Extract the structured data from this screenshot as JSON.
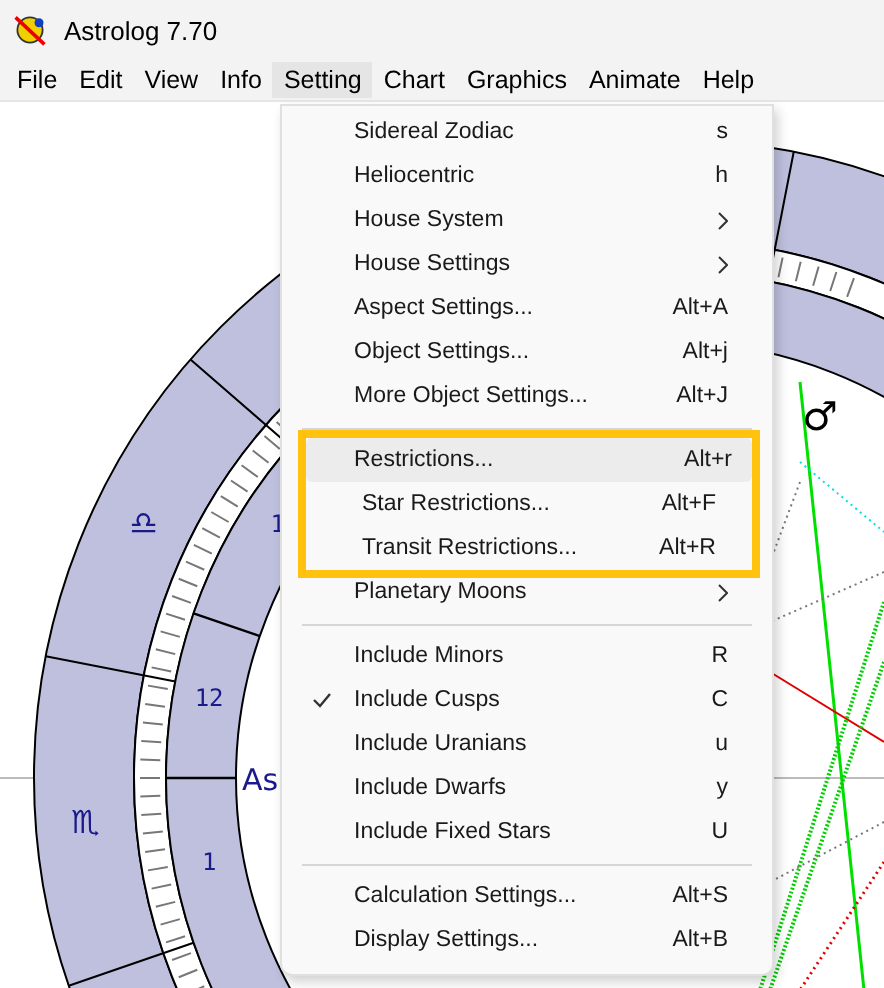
{
  "window": {
    "title": "Astrolog 7.70"
  },
  "menubar": [
    {
      "label": "File",
      "selected": false
    },
    {
      "label": "Edit",
      "selected": false
    },
    {
      "label": "View",
      "selected": false
    },
    {
      "label": "Info",
      "selected": false
    },
    {
      "label": "Setting",
      "selected": true
    },
    {
      "label": "Chart",
      "selected": false
    },
    {
      "label": "Graphics",
      "selected": false
    },
    {
      "label": "Animate",
      "selected": false
    },
    {
      "label": "Help",
      "selected": false
    }
  ],
  "chart": {
    "signs": [
      {
        "glyph": "♎"
      },
      {
        "glyph": "♏"
      }
    ],
    "houses": [
      {
        "label": "1"
      },
      {
        "label": "12"
      },
      {
        "label": "1"
      }
    ],
    "ascendant": "As",
    "planet": "♂"
  },
  "menu": {
    "groups": [
      {
        "highlighted": false,
        "items": [
          {
            "label": "Sidereal Zodiac",
            "shortcut": "s",
            "submenu": false,
            "checked": false,
            "selected": false
          },
          {
            "label": "Heliocentric",
            "shortcut": "h",
            "submenu": false,
            "checked": false,
            "selected": false
          },
          {
            "label": "House System",
            "submenu": true,
            "checked": false,
            "selected": false
          },
          {
            "label": "House Settings",
            "submenu": true,
            "checked": false,
            "selected": false
          },
          {
            "label": "Aspect Settings...",
            "shortcut": "Alt+A",
            "submenu": false,
            "checked": false,
            "selected": false
          },
          {
            "label": "Object Settings...",
            "shortcut": "Alt+j",
            "submenu": false,
            "checked": false,
            "selected": false
          },
          {
            "label": "More Object Settings...",
            "shortcut": "Alt+J",
            "submenu": false,
            "checked": false,
            "selected": false
          }
        ]
      },
      {
        "highlighted": true,
        "items": [
          {
            "label": "Restrictions...",
            "shortcut": "Alt+r",
            "submenu": false,
            "checked": false,
            "selected": true
          },
          {
            "label": "Star Restrictions...",
            "shortcut": "Alt+F",
            "submenu": false,
            "checked": false,
            "selected": false
          },
          {
            "label": "Transit Restrictions...",
            "shortcut": "Alt+R",
            "submenu": false,
            "checked": false,
            "selected": false
          }
        ]
      },
      {
        "highlighted": false,
        "items": [
          {
            "label": "Planetary Moons",
            "submenu": true,
            "checked": false,
            "selected": false
          }
        ]
      },
      {
        "highlighted": false,
        "items": [
          {
            "label": "Include Minors",
            "shortcut": "R",
            "submenu": false,
            "checked": false,
            "selected": false
          },
          {
            "label": "Include Cusps",
            "shortcut": "C",
            "submenu": false,
            "checked": true,
            "selected": false
          },
          {
            "label": "Include Uranians",
            "shortcut": "u",
            "submenu": false,
            "checked": false,
            "selected": false
          },
          {
            "label": "Include Dwarfs",
            "shortcut": "y",
            "submenu": false,
            "checked": false,
            "selected": false
          },
          {
            "label": "Include Fixed Stars",
            "shortcut": "U",
            "submenu": false,
            "checked": false,
            "selected": false
          }
        ]
      },
      {
        "highlighted": false,
        "items": [
          {
            "label": "Calculation Settings...",
            "shortcut": "Alt+S",
            "submenu": false,
            "checked": false,
            "selected": false
          },
          {
            "label": "Display Settings...",
            "shortcut": "Alt+B",
            "submenu": false,
            "checked": false,
            "selected": false
          }
        ]
      }
    ]
  }
}
